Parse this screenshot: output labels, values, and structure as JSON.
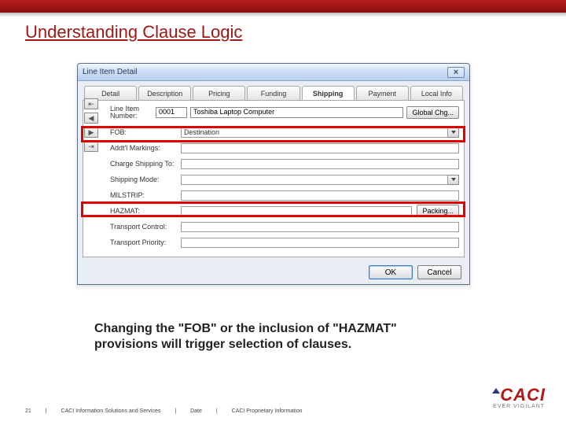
{
  "slide": {
    "title": "Understanding Clause Logic",
    "caption": "Changing the \"FOB\" or the inclusion of \"HAZMAT\" provisions will trigger selection of clauses.",
    "page_number": "21"
  },
  "footer": {
    "org": "CACI Information Solutions and Services",
    "date_label": "Date",
    "classification": "CACI Proprietary Information"
  },
  "logo": {
    "name": "CACI",
    "tagline": "EVER VIGILANT"
  },
  "dialog": {
    "title": "Line Item Detail",
    "close": "×",
    "tabs": [
      "Detail",
      "Description",
      "Pricing",
      "Funding",
      "Shipping",
      "Payment",
      "Local Info"
    ],
    "active_tab": 4,
    "lineitem_label": "Line Item Number:",
    "lineitem_number": "0001",
    "lineitem_desc": "Toshiba Laptop Computer",
    "global_btn": "Global Chg...",
    "fields": [
      {
        "label": "FOB:",
        "value": "Destination",
        "dropdown": true
      },
      {
        "label": "Addt'l Markings:",
        "value": "",
        "dropdown": false
      },
      {
        "label": "Charge Shipping To:",
        "value": "",
        "dropdown": false
      },
      {
        "label": "Shipping Mode:",
        "value": "",
        "dropdown": true
      },
      {
        "label": "MILSTRIP:",
        "value": "",
        "dropdown": false
      },
      {
        "label": "HAZMAT:",
        "value": "",
        "dropdown": false,
        "rbtn": "Packing..."
      },
      {
        "label": "Transport Control:",
        "value": "",
        "dropdown": false
      },
      {
        "label": "Transport Priority:",
        "value": "",
        "dropdown": false
      }
    ],
    "ok": "OK",
    "cancel": "Cancel"
  }
}
